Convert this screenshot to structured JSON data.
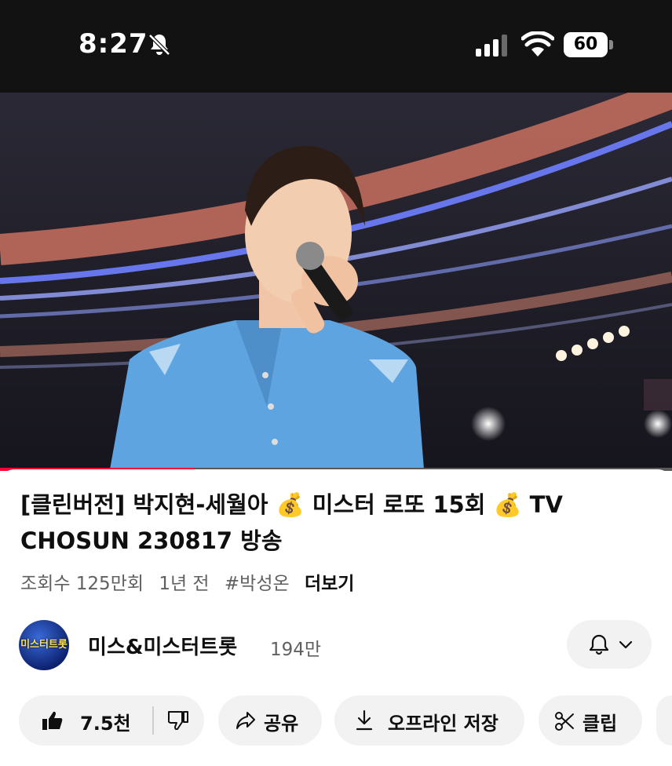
{
  "status_bar": {
    "time": "8:27",
    "battery": "60"
  },
  "video": {
    "progress": 0.29
  },
  "title": "[클린버전] 박지현-세월아 💰 미스터 로또 15회 💰 TV CHOSUN 230817 방송",
  "meta": {
    "views": "조회수 125만회",
    "age": "1년 전",
    "hashtag": "#박성온",
    "more": "더보기"
  },
  "channel": {
    "name": "미스&미스터트롯",
    "subscribers": "194만",
    "avatar_text": "미스터트롯3"
  },
  "actions": {
    "likes": "7.5천",
    "share": "공유",
    "download": "오프라인 저장",
    "clip": "클립"
  },
  "colors": {
    "accent": "#ff0033",
    "pill": "#f2f2f2",
    "secondary_text": "#606060"
  }
}
